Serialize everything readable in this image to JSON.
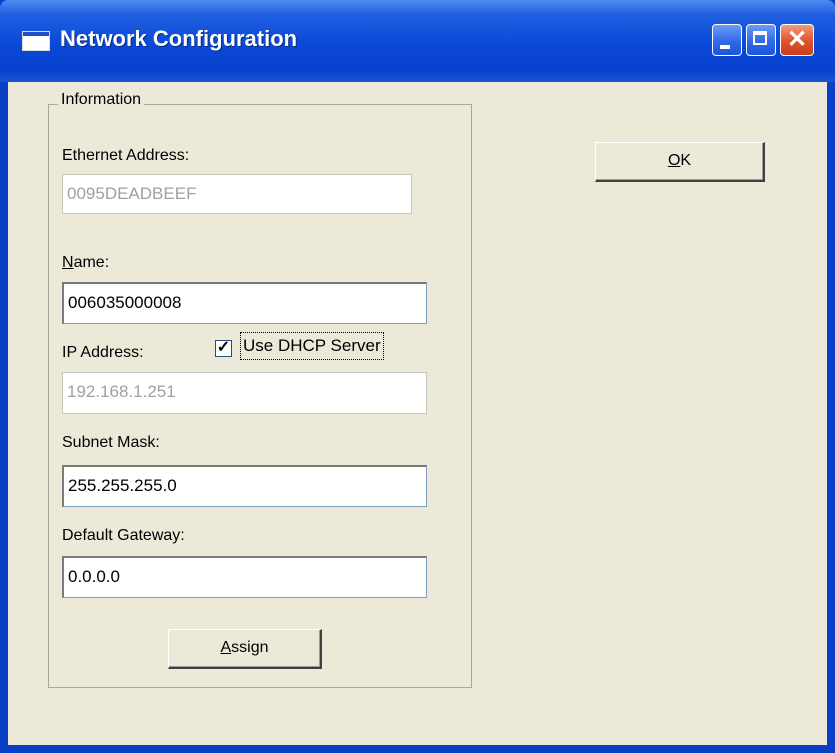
{
  "window": {
    "title": "Network Configuration",
    "close_glyph": "✕"
  },
  "group": {
    "title": "Information"
  },
  "fields": {
    "ethernet_label": "Ethernet Address:",
    "ethernet_value": "0095DEADBEEF",
    "name_label_mnemonic": "N",
    "name_label_rest": "ame:",
    "name_value": "006035000008",
    "ip_label": "IP Address:",
    "ip_value": "192.168.1.251",
    "dhcp_label": "Use DHCP Server",
    "dhcp_checked_glyph": "✓",
    "subnet_label": "Subnet Mask:",
    "subnet_value": "255.255.255.0",
    "gateway_label": "Default Gateway:",
    "gateway_value": "0.0.0.0"
  },
  "buttons": {
    "ok_mnemonic": "O",
    "ok_rest": "K",
    "assign_mnemonic": "A",
    "assign_rest": "ssign"
  },
  "colors": {
    "titlebar": "#0a48d8",
    "client": "#ece9d8",
    "close_button": "#e0522a"
  },
  "state": {
    "dhcp_enabled": true
  }
}
